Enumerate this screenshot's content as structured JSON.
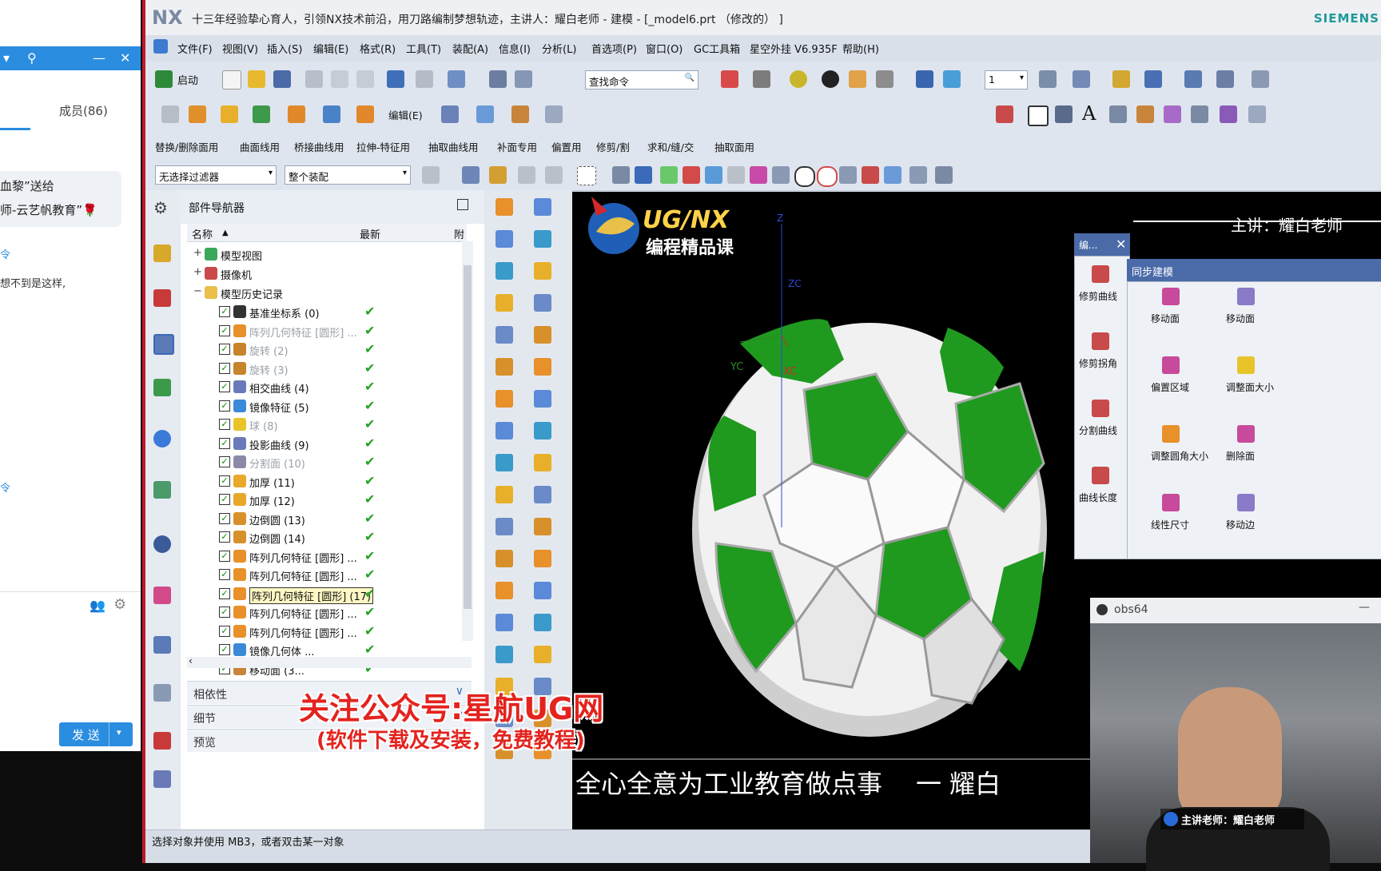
{
  "chat": {
    "members_tab": "成员(86)",
    "gift_line1": "血黎”送给",
    "gift_line2": "师-云艺帆教育”🌹",
    "msg_line1": "令",
    "msg_line2": "想不到是这样,",
    "msg_line3": "令",
    "send_button": "发 送"
  },
  "window": {
    "logo": "NX",
    "title": "十三年经验挚心育人，引领NX技术前沿，用刀路编制梦想轨迹，主讲人：耀白老师 - 建模 - [_model6.prt （修改的） ]",
    "brand": "SIEMENS"
  },
  "menu": [
    "文件(F)",
    "视图(V)",
    "插入(S)",
    "编辑(E)",
    "格式(R)",
    "工具(T)",
    "装配(A)",
    "信息(I)",
    "分析(L)",
    "首选项(P)",
    "窗口(O)",
    "GC工具箱",
    "星空外挂 V6.935F",
    "帮助(H)"
  ],
  "toolbar1": {
    "start": "启动",
    "search_placeholder": "查找命令",
    "layer": "1"
  },
  "toolbar2": {
    "edit": "编辑(E)"
  },
  "cmdrow": [
    "替换/删除面用",
    "曲面线用",
    "桥接曲线用",
    "拉伸-特征用",
    "抽取曲线用",
    "补面专用",
    "偏置用",
    "修剪/割",
    "求和/缝/交",
    "抽取面用"
  ],
  "filters": {
    "filter": "无选择过滤器",
    "scope": "整个装配"
  },
  "navigator": {
    "title": "部件导航器",
    "col_name": "名称",
    "col_latest": "最新",
    "col_extra": "附",
    "nodes": [
      {
        "label": "模型视图",
        "type": "top"
      },
      {
        "label": "摄像机",
        "type": "top"
      },
      {
        "label": "模型历史记录",
        "type": "top"
      }
    ],
    "features": [
      {
        "label": "基准坐标系 (0)",
        "dim": false
      },
      {
        "label": "阵列几何特征 [圆形] ...",
        "dim": true
      },
      {
        "label": "旋转 (2)",
        "dim": true
      },
      {
        "label": "旋转 (3)",
        "dim": true
      },
      {
        "label": "相交曲线 (4)",
        "dim": false
      },
      {
        "label": "镜像特征 (5)",
        "dim": false
      },
      {
        "label": "球 (8)",
        "dim": true
      },
      {
        "label": "投影曲线 (9)",
        "dim": false
      },
      {
        "label": "分割面 (10)",
        "dim": true
      },
      {
        "label": "加厚 (11)",
        "dim": false
      },
      {
        "label": "加厚 (12)",
        "dim": false
      },
      {
        "label": "边倒圆 (13)",
        "dim": false
      },
      {
        "label": "边倒圆 (14)",
        "dim": false
      },
      {
        "label": "阵列几何特征 [圆形] ...",
        "dim": false
      },
      {
        "label": "阵列几何特征 [圆形] ...",
        "dim": false
      },
      {
        "label": "阵列几何特征 [圆形] (17)",
        "dim": false
      },
      {
        "label": "阵列几何特征 [圆形] ...",
        "dim": false
      },
      {
        "label": "阵列几何特征 [圆形] ...",
        "dim": false
      },
      {
        "label": "镜像几何体 ...",
        "dim": false
      },
      {
        "label": "移动面 (3...",
        "dim": false
      }
    ],
    "sections": [
      "相依性",
      "细节",
      "预览"
    ]
  },
  "viewport": {
    "course_title": "UG/NX",
    "course_subtitle": "编程精品课",
    "presenter": "主讲：耀白老师",
    "axis_z": "Z",
    "axis_yc": "YC",
    "axis_xc": "XC",
    "axis_zc": "ZC",
    "slogan": "全心全意为工业教育做点事",
    "signature": "一 耀白"
  },
  "watermark": {
    "line1": "关注公众号:星航UG网",
    "line2": "(软件下载及安装，免费教程)"
  },
  "sync_panel": {
    "tab": "编...",
    "title": "同步建模",
    "left_items": [
      "修剪曲线",
      "修剪拐角",
      "分割曲线",
      "曲线长度"
    ],
    "grid_items": [
      "移动面",
      "移动面",
      "偏置区域",
      "调整面大小",
      "调整圆角大小",
      "删除面",
      "线性尺寸",
      "移动边"
    ]
  },
  "obs": {
    "title": "obs64",
    "badge": "主讲老师：耀白老师"
  },
  "status": {
    "text": "选择对象并使用 MB3，或者双击某一对象"
  },
  "colors": {
    "accent": "#2a8de0",
    "ball_green": "#1f9a1f",
    "check_green": "#22a322"
  }
}
